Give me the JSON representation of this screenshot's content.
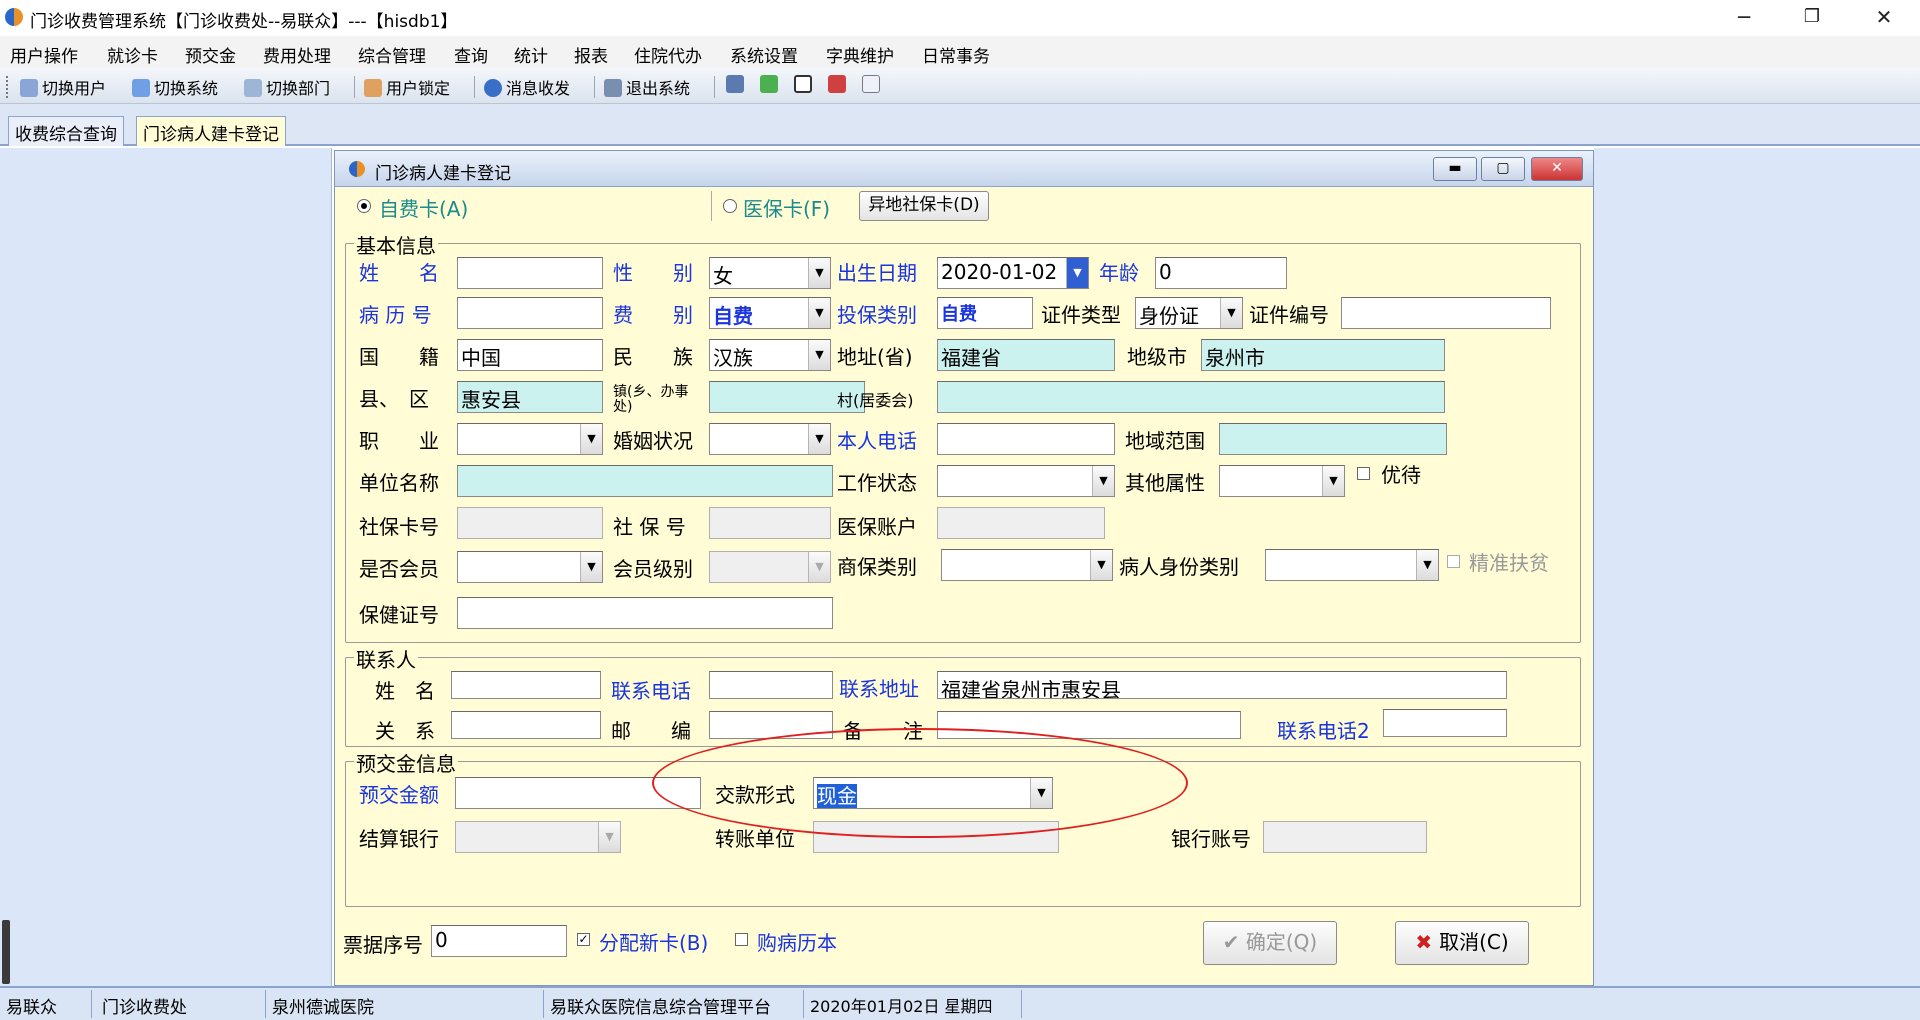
{
  "window": {
    "title": "门诊收费管理系统【门诊收费处--易联众】---【hisdb1】",
    "minimize": "─",
    "restore": "❐",
    "close": "✕"
  },
  "menu": [
    "用户操作",
    "就诊卡",
    "预交金",
    "费用处理",
    "综合管理",
    "查询",
    "统计",
    "报表",
    "住院代办",
    "系统设置",
    "字典维护",
    "日常事务"
  ],
  "toolbar": {
    "switch_user": "切换用户",
    "switch_system": "切换系统",
    "switch_dept": "切换部门",
    "user_lock": "用户锁定",
    "message": "消息收发",
    "exit": "退出系统"
  },
  "tabs": [
    "收费综合查询",
    "门诊病人建卡登记"
  ],
  "dialog": {
    "title": "门诊病人建卡登记",
    "card_type": {
      "self_pay": "自费卡(A)",
      "insurance": "医保卡(F)",
      "remote_btn": "异地社保卡(D)",
      "selected": "self_pay"
    },
    "basic": {
      "legend": "基本信息",
      "name_label": "姓　　名",
      "name": "",
      "gender_label": "性　　别",
      "gender": "女",
      "dob_label": "出生日期",
      "dob": "2020-01-02",
      "age_label": "年龄",
      "age": "0",
      "record_label": "病 历 号",
      "record": "",
      "fee_label": "费　　别",
      "fee": "自费",
      "ins_type_label": "投保类别",
      "ins_type": "自费",
      "id_type_label": "证件类型",
      "id_type": "身份证",
      "id_no_label": "证件编号",
      "id_no": "",
      "nation_label": "国　　籍",
      "nation": "中国",
      "ethnic_label": "民　　族",
      "ethnic": "汉族",
      "province_label": "地址(省)",
      "province": "福建省",
      "city_label": "地级市",
      "city": "泉州市",
      "county_label": "县、　区",
      "county": "惠安县",
      "town_label": "镇(乡、办事处)",
      "town": "",
      "village_label": "村(居委会)",
      "village": "",
      "job_label": "职　　业",
      "job": "",
      "marital_label": "婚姻状况",
      "marital": "",
      "phone_label": "本人电话",
      "phone": "",
      "region_label": "地域范围",
      "region": "",
      "employer_label": "单位名称",
      "employer": "",
      "work_status_label": "工作状态",
      "work_status": "",
      "other_attr_label": "其他属性",
      "other_attr": "",
      "vip_label": "优待",
      "ss_card_label": "社保卡号",
      "ss_card": "",
      "ss_no_label": "社 保 号",
      "ss_no": "",
      "med_acct_label": "医保账户",
      "med_acct": "",
      "member_label": "是否会员",
      "member": "",
      "member_level_label": "会员级别",
      "member_level": "",
      "comm_ins_label": "商保类别",
      "comm_ins": "",
      "patient_id_type_label": "病人身份类别",
      "patient_id_type": "",
      "poverty_label": "精准扶贫",
      "health_card_label": "保健证号",
      "health_card": ""
    },
    "contact": {
      "legend": "联系人",
      "name_label": "姓　名",
      "name": "",
      "phone_label": "联系电话",
      "phone": "",
      "addr_label": "联系地址",
      "addr": "福建省泉州市惠安县",
      "relation_label": "关　系",
      "relation": "",
      "zip_label": "邮　　编",
      "zip": "",
      "note_label": "备　　注",
      "note": "",
      "phone2_label": "联系电话2",
      "phone2": ""
    },
    "prepay": {
      "legend": "预交金信息",
      "amount_label": "预交金额",
      "amount": "",
      "method_label": "交款形式",
      "method": "现金",
      "bank_label": "结算银行",
      "bank": "",
      "transfer_label": "转账单位",
      "transfer": "",
      "acct_label": "银行账号",
      "acct": ""
    },
    "footer": {
      "receipt_label": "票据序号",
      "receipt": "0",
      "new_card_label": "分配新卡(B)",
      "buy_record_label": "购病历本",
      "ok": "确定(Q)",
      "cancel": "取消(C)"
    }
  },
  "status": [
    "易联众",
    "门诊收费处",
    "泉州德诚医院",
    "易联众医院信息综合管理平台",
    "2020年01月02日 星期四"
  ]
}
